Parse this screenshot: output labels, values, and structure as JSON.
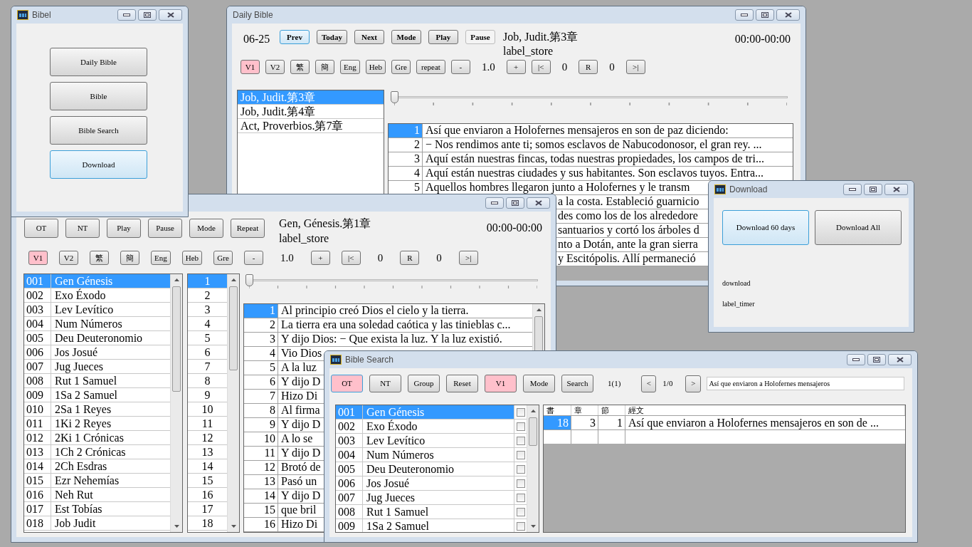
{
  "launcher": {
    "title": "Bibel",
    "icon": true,
    "buttons": [
      {
        "label": "Daily Bible",
        "focused": false
      },
      {
        "label": "Bible",
        "focused": false
      },
      {
        "label": "Bible Search",
        "focused": false
      },
      {
        "label": "Download",
        "focused": true
      }
    ]
  },
  "daily_bible": {
    "title": "Daily Bible",
    "icon": false,
    "date": "06-25",
    "buttons": [
      {
        "label": "Prev",
        "focused": true,
        "disabled": false
      },
      {
        "label": "Today",
        "focused": false,
        "disabled": false
      },
      {
        "label": "Next",
        "focused": false,
        "disabled": false
      },
      {
        "label": "Mode",
        "focused": false,
        "disabled": false
      },
      {
        "label": "Play",
        "focused": false,
        "disabled": false
      },
      {
        "label": "Pause",
        "focused": false,
        "disabled": true
      }
    ],
    "chapter": "Job, Judit.第3章",
    "store": "label_store",
    "time": "00:00-00:00",
    "toolbar": [
      {
        "kind": "toggle",
        "label": "V1",
        "selected": true
      },
      {
        "kind": "toggle",
        "label": "V2",
        "selected": false
      },
      {
        "kind": "toggle",
        "label": "繁",
        "selected": false
      },
      {
        "kind": "toggle",
        "label": "簡",
        "selected": false
      },
      {
        "kind": "toggle",
        "label": "Eng",
        "selected": false
      },
      {
        "kind": "toggle",
        "label": "Heb",
        "selected": false
      },
      {
        "kind": "toggle",
        "label": "Gre",
        "selected": false
      },
      {
        "kind": "button",
        "label": "repeat"
      },
      {
        "kind": "button",
        "label": "-"
      },
      {
        "kind": "value",
        "label": "1.0"
      },
      {
        "kind": "button",
        "label": "+"
      },
      {
        "kind": "button",
        "label": "|<"
      },
      {
        "kind": "value",
        "label": "0"
      },
      {
        "kind": "button",
        "label": "R"
      },
      {
        "kind": "value",
        "label": "0"
      },
      {
        "kind": "button",
        "label": ">|"
      }
    ],
    "readings": [
      {
        "text": "Job, Judit.第3章",
        "selected": true
      },
      {
        "text": "Job, Judit.第4章",
        "selected": false
      },
      {
        "text": "Act, Proverbios.第7章",
        "selected": false
      }
    ],
    "slider": {
      "level": 0
    },
    "verses": [
      {
        "kind": "line",
        "number": "1",
        "text": "Así que enviaron a Holofernes mensajeros en son de paz diciendo:",
        "selected": true
      },
      {
        "kind": "line",
        "number": "2",
        "text": "− Nos rendimos ante ti; somos esclavos de Nabucodonosor, el gran rey. ...",
        "selected": false
      },
      {
        "kind": "line",
        "number": "3",
        "text": "Aquí están nuestras fincas, todas nuestras propiedades, los campos de tri...",
        "selected": false
      },
      {
        "kind": "line",
        "number": "4",
        "text": "Aquí están nuestras ciudades y sus habitantes. Son esclavos tuyos. Entra...",
        "selected": false
      },
      {
        "kind": "line",
        "number": "5",
        "text": "Aquellos hombres llegaron junto a Holofernes y le transm",
        "selected": false
      },
      {
        "kind": "tail",
        "text": "a la costa. Estableció guarnicio"
      },
      {
        "kind": "tail",
        "text": "des como los de los alrededore"
      },
      {
        "kind": "tail",
        "text": "santuarios y cortó los árboles d"
      },
      {
        "kind": "tail",
        "text": "nto a Dotán, ante la gran sierra"
      },
      {
        "kind": "tail",
        "text": "y Escitópolis. Allí permaneció"
      }
    ]
  },
  "bible": {
    "buttons": [
      {
        "label": "OT"
      },
      {
        "label": "NT"
      },
      {
        "label": "Play"
      },
      {
        "label": "Pause"
      },
      {
        "label": "Mode"
      },
      {
        "label": "Repeat"
      }
    ],
    "chapter": "Gen, Génesis.第1章",
    "store": "label_store",
    "time": "00:00-00:00",
    "toolbar": [
      {
        "kind": "toggle",
        "label": "V1",
        "selected": true
      },
      {
        "kind": "toggle",
        "label": "V2",
        "selected": false
      },
      {
        "kind": "toggle",
        "label": "繁",
        "selected": false
      },
      {
        "kind": "toggle",
        "label": "簡",
        "selected": false
      },
      {
        "kind": "toggle",
        "label": "Eng",
        "selected": false
      },
      {
        "kind": "toggle",
        "label": "Heb",
        "selected": false
      },
      {
        "kind": "toggle",
        "label": "Gre",
        "selected": false
      },
      {
        "kind": "button",
        "label": "-"
      },
      {
        "kind": "value",
        "label": "1.0"
      },
      {
        "kind": "button",
        "label": "+"
      },
      {
        "kind": "button",
        "label": "|<"
      },
      {
        "kind": "value",
        "label": "0"
      },
      {
        "kind": "button",
        "label": "R"
      },
      {
        "kind": "value",
        "label": "0"
      },
      {
        "kind": "button",
        "label": ">|"
      }
    ],
    "books": [
      {
        "code": "001",
        "name": "Gen Génesis",
        "selected": true
      },
      {
        "code": "002",
        "name": "Exo Éxodo",
        "selected": false
      },
      {
        "code": "003",
        "name": "Lev Levítico",
        "selected": false
      },
      {
        "code": "004",
        "name": "Num Números",
        "selected": false
      },
      {
        "code": "005",
        "name": "Deu Deuteronomio",
        "selected": false
      },
      {
        "code": "006",
        "name": "Jos Josué",
        "selected": false
      },
      {
        "code": "007",
        "name": "Jug Jueces",
        "selected": false
      },
      {
        "code": "008",
        "name": "Rut 1 Samuel",
        "selected": false
      },
      {
        "code": "009",
        "name": "1Sa 2 Samuel",
        "selected": false
      },
      {
        "code": "010",
        "name": "2Sa 1 Reyes",
        "selected": false
      },
      {
        "code": "011",
        "name": "1Ki 2 Reyes",
        "selected": false
      },
      {
        "code": "012",
        "name": "2Ki 1 Crónicas",
        "selected": false
      },
      {
        "code": "013",
        "name": "1Ch 2 Crónicas",
        "selected": false
      },
      {
        "code": "014",
        "name": "2Ch Esdras",
        "selected": false
      },
      {
        "code": "015",
        "name": "Ezr Nehemías",
        "selected": false
      },
      {
        "code": "016",
        "name": "Neh Rut",
        "selected": false
      },
      {
        "code": "017",
        "name": "Est Tobías",
        "selected": false
      },
      {
        "code": "018",
        "name": "Job Judit",
        "selected": false
      }
    ],
    "chapters": [
      {
        "text": "1",
        "selected": true
      },
      {
        "text": "2",
        "selected": false
      },
      {
        "text": "3",
        "selected": false
      },
      {
        "text": "4",
        "selected": false
      },
      {
        "text": "5",
        "selected": false
      },
      {
        "text": "6",
        "selected": false
      },
      {
        "text": "7",
        "selected": false
      },
      {
        "text": "8",
        "selected": false
      },
      {
        "text": "9",
        "selected": false
      },
      {
        "text": "10",
        "selected": false
      },
      {
        "text": "11",
        "selected": false
      },
      {
        "text": "12",
        "selected": false
      },
      {
        "text": "13",
        "selected": false
      },
      {
        "text": "14",
        "selected": false
      },
      {
        "text": "15",
        "selected": false
      },
      {
        "text": "16",
        "selected": false
      },
      {
        "text": "17",
        "selected": false
      },
      {
        "text": "18",
        "selected": false
      }
    ],
    "slider": {
      "level": 0
    },
    "verses": [
      {
        "kind": "line",
        "number": "1",
        "text": "Al principio creó Dios el cielo y la tierra.",
        "selected": true
      },
      {
        "kind": "line",
        "number": "2",
        "text": "La tierra era una soledad caótica y las tinieblas c...",
        "selected": false
      },
      {
        "kind": "line",
        "number": "3",
        "text": "Y dijo Dios:  − Que exista la luz. Y la luz existió.",
        "selected": false
      },
      {
        "kind": "line",
        "number": "4",
        "text": "Vio Dios",
        "selected": false
      },
      {
        "kind": "line",
        "number": "5",
        "text": "A la luz",
        "selected": false
      },
      {
        "kind": "line",
        "number": "6",
        "text": "Y dijo D",
        "selected": false
      },
      {
        "kind": "line",
        "number": "7",
        "text": "Hizo Di",
        "selected": false
      },
      {
        "kind": "line",
        "number": "8",
        "text": "Al firma",
        "selected": false
      },
      {
        "kind": "line",
        "number": "9",
        "text": "Y dijo D",
        "selected": false
      },
      {
        "kind": "line",
        "number": "10",
        "text": "A lo se",
        "selected": false
      },
      {
        "kind": "line",
        "number": "11",
        "text": "Y dijo D",
        "selected": false
      },
      {
        "kind": "line",
        "number": "12",
        "text": "Brotó de",
        "selected": false
      },
      {
        "kind": "line",
        "number": "13",
        "text": "Pasó un",
        "selected": false
      },
      {
        "kind": "line",
        "number": "14",
        "text": "Y dijo D",
        "selected": false
      },
      {
        "kind": "line",
        "number": "15",
        "text": "que bril",
        "selected": false
      },
      {
        "kind": "line",
        "number": "16",
        "text": "Hizo Di",
        "selected": false
      }
    ]
  },
  "download": {
    "title": "Download",
    "icon": true,
    "buttons": [
      {
        "label": "Download 60 days",
        "focused": true
      },
      {
        "label": "Download All",
        "focused": false
      }
    ],
    "status": "download",
    "timer": "label_timer"
  },
  "bible_search": {
    "title": "Bible Search",
    "icon": true,
    "buttons": [
      {
        "label": "OT",
        "selected": true,
        "focused": true
      },
      {
        "label": "NT",
        "selected": false,
        "focused": false
      },
      {
        "label": "Group",
        "selected": false,
        "focused": false
      },
      {
        "label": "Reset",
        "selected": false,
        "focused": false
      },
      {
        "label": "V1",
        "selected": true,
        "focused": false
      },
      {
        "label": "Mode",
        "selected": false,
        "focused": false
      },
      {
        "label": "Search",
        "selected": false,
        "focused": false
      }
    ],
    "count": "1(1)",
    "prev": "<",
    "page": "1/0",
    "next": ">",
    "query": "Así que enviaron a Holofernes mensajeros",
    "books": [
      {
        "code": "001",
        "name": "Gen Génesis",
        "selected": true,
        "checked": false
      },
      {
        "code": "002",
        "name": "Exo Éxodo",
        "selected": false,
        "checked": false
      },
      {
        "code": "003",
        "name": "Lev Levítico",
        "selected": false,
        "checked": false
      },
      {
        "code": "004",
        "name": "Num Números",
        "selected": false,
        "checked": false
      },
      {
        "code": "005",
        "name": "Deu Deuteronomio",
        "selected": false,
        "checked": false
      },
      {
        "code": "006",
        "name": "Jos Josué",
        "selected": false,
        "checked": false
      },
      {
        "code": "007",
        "name": "Jug Jueces",
        "selected": false,
        "checked": false
      },
      {
        "code": "008",
        "name": "Rut 1 Samuel",
        "selected": false,
        "checked": false
      },
      {
        "code": "009",
        "name": "1Sa 2 Samuel",
        "selected": false,
        "checked": false
      }
    ],
    "results": {
      "columns": [
        "書",
        "章",
        "節",
        "經文"
      ],
      "rows": [
        {
          "book": "18",
          "chapter": "3",
          "verse": "1",
          "text": "Así que enviaron a Holofernes mensajeros en son de ...",
          "selected": true
        }
      ]
    }
  }
}
